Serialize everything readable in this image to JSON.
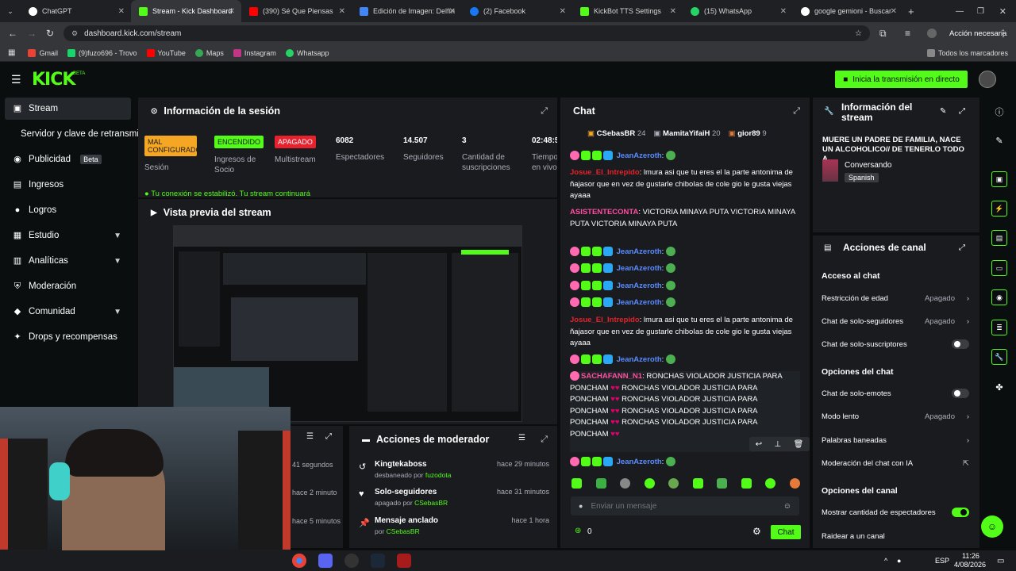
{
  "browser": {
    "tabs": [
      {
        "title": "ChatGPT",
        "color": "#ffffff"
      },
      {
        "title": "Stream - Kick Dashboard",
        "color": "#53fc18"
      },
      {
        "title": "(390) Sé Que Piensas",
        "color": "#ff0000"
      },
      {
        "title": "Edición de Imagen: Delfín",
        "color": "#4285f4"
      },
      {
        "title": "(2) Facebook",
        "color": "#1877f2"
      },
      {
        "title": "KickBot TTS Settings",
        "color": "#53fc18"
      },
      {
        "title": "(15) WhatsApp",
        "color": "#25d366"
      },
      {
        "title": "google gemioni - Buscar",
        "color": "#ffffff"
      }
    ],
    "new_tab": "+",
    "url": "dashboard.kick.com/stream",
    "action_label": "Acción necesaria",
    "bookmarks": [
      "Gmail",
      "(9)fuzo696 - Trovo",
      "YouTube",
      "Maps",
      "Instagram",
      "Whatsapp"
    ],
    "all_bookmarks": "Todos los marcadores"
  },
  "kick": {
    "logo": "KICK",
    "logo_tag": "BETA",
    "go_live": "Inicia la transmisión en directo",
    "sidebar": [
      {
        "label": "Stream",
        "icon": "stream-icon"
      },
      {
        "label": "Servidor y clave de retransmisión",
        "icon": ""
      },
      {
        "label": "Publicidad",
        "icon": "megaphone-icon",
        "badge": "Beta"
      },
      {
        "label": "Ingresos",
        "icon": "money-icon"
      },
      {
        "label": "Logros",
        "icon": "trophy-icon"
      },
      {
        "label": "Estudio",
        "icon": "studio-icon"
      },
      {
        "label": "Analíticas",
        "icon": "chart-icon"
      },
      {
        "label": "Moderación",
        "icon": "shield-icon"
      },
      {
        "label": "Comunidad",
        "icon": "community-icon"
      },
      {
        "label": "Drops y recompensas",
        "icon": "gift-icon"
      }
    ],
    "session": {
      "title": "Información de la sesión",
      "stats": [
        {
          "value": "MAL CONFIGURADO",
          "label": "Sesión",
          "badge_color": "#f5a623"
        },
        {
          "value": "ENCENDIDO",
          "label": "Ingresos de Socio",
          "badge_color": "#53fc18"
        },
        {
          "value": "APAGADO",
          "label": "Multistream",
          "badge_color": "#e5222d"
        },
        {
          "value": "6082",
          "label": "Espectadores"
        },
        {
          "value": "14.507",
          "label": "Seguidores"
        },
        {
          "value": "3",
          "label": "Cantidad de suscripciones"
        },
        {
          "value": "02:48:5",
          "label": "Tiempo en vivo"
        }
      ],
      "connection": "Tu conexión se estabilizó. Tu stream continuará"
    },
    "preview": {
      "title": "Vista previa del stream"
    },
    "mod_actions": {
      "title": "Acciones de moderador",
      "items": [
        {
          "title": "Kingtekaboss",
          "sub_pre": "desbaneado por",
          "sub_user": "fuzodota",
          "time": "hace 29 minutos"
        },
        {
          "title": "Solo-seguidores",
          "sub_pre": "apagado por",
          "sub_user": "CSebasBR",
          "time": "hace 31 minutos"
        },
        {
          "title": "Mensaje anclado",
          "sub_pre": "por",
          "sub_user": "CSebasBR",
          "time": "hace 1 hora"
        }
      ],
      "left_times": [
        "41 segundos",
        "hace 2 minuto",
        "hace 5 minutos"
      ]
    },
    "chat": {
      "title": "Chat",
      "top": [
        {
          "name": "CSebasBR",
          "count": "24"
        },
        {
          "name": "MamitaYifaiH",
          "count": "20"
        },
        {
          "name": "gior89",
          "count": "9"
        }
      ],
      "messages": [
        {
          "user": "JeanAzeroth",
          "text": "",
          "color": "#5b8cff"
        },
        {
          "user": "Josue_El_Intrepido",
          "text": "lmura asi que tu eres el la parte antonima de ñajasor que en vez de gustarle chiboIas de cole gio le gusta viejas ayaaa",
          "color": "#e5222d"
        },
        {
          "user": "ASISTENTECONTA",
          "text": "VICTORIA MINAYA PUTA VICTORIA MINAYA PUTA VICTORIA MINAYA PUTA",
          "color": "#ff4fa0"
        },
        {
          "user": "JeanAzeroth",
          "text": "",
          "color": "#5b8cff"
        },
        {
          "user": "JeanAzeroth",
          "text": "",
          "color": "#5b8cff"
        },
        {
          "user": "JeanAzeroth",
          "text": "",
          "color": "#5b8cff"
        },
        {
          "user": "JeanAzeroth",
          "text": "",
          "color": "#5b8cff"
        },
        {
          "user": "Josue_El_Intrepido",
          "text": "lmura asi que tu eres el la parte antonima de ñajasor que en vez de gustarle chiboIas de cole gio le gusta viejas ayaaa",
          "color": "#e5222d"
        },
        {
          "user": "JeanAzeroth",
          "text": "",
          "color": "#5b8cff"
        },
        {
          "user": "SACHAFANN_N1",
          "text": "RONCHAS VIOLADOR JUSTICIA PARA",
          "color": "#ff4fa0"
        },
        {
          "user": "JeanAzeroth",
          "text": "",
          "color": "#5b8cff"
        }
      ],
      "spam_lines": [
        [
          "PONCHAM",
          "RONCHAS VIOLADOR JUSTICIA PARA"
        ],
        [
          "PONCHAM",
          "RONCHAS VIOLADOR JUSTICIA PARA"
        ],
        [
          "PONCHAM",
          "RONCHAS VIOLADOR JUSTICIA PARA"
        ],
        [
          "PONCHAM",
          "RONCHAS VIOLADOR JUSTICIA PARA"
        ],
        [
          "PONCHAM",
          ""
        ]
      ],
      "input_placeholder": "Enviar un mensaje",
      "points": "0",
      "send_label": "Chat"
    },
    "channel_info": {
      "title": "Información del stream",
      "stream_title": "MUERE UN PADRE DE FAMILIA, NACE UN ALCOHOLICO// DE TENERLO TODO A...",
      "category": "Conversando",
      "language": "Spanish"
    },
    "channel_actions": {
      "title": "Acciones de canal",
      "sections": [
        {
          "heading": "Acceso al chat",
          "rows": [
            {
              "label": "Restricción de edad",
              "value": "Apagado",
              "kind": "arrow"
            },
            {
              "label": "Chat de solo-seguidores",
              "value": "Apagado",
              "kind": "arrow"
            },
            {
              "label": "Chat de solo-suscriptores",
              "value": "",
              "kind": "toggle-off"
            }
          ]
        },
        {
          "heading": "Opciones del chat",
          "rows": [
            {
              "label": "Chat de solo-emotes",
              "value": "",
              "kind": "toggle-off"
            },
            {
              "label": "Modo lento",
              "value": "Apagado",
              "kind": "arrow"
            },
            {
              "label": "Palabras baneadas",
              "value": "",
              "kind": "arrow"
            },
            {
              "label": "Moderación del chat con IA",
              "value": "",
              "kind": "external"
            }
          ]
        },
        {
          "heading": "Opciones del canal",
          "rows": [
            {
              "label": "Mostrar cantidad de espectadores",
              "value": "",
              "kind": "toggle-on"
            },
            {
              "label": "Raidear a un canal",
              "value": "",
              "kind": "none"
            }
          ]
        }
      ]
    }
  },
  "taskbar": {
    "time": "11:26",
    "date": "4/08/2026",
    "lang": "ESP"
  },
  "colors": {
    "accent": "#53fc18",
    "panel": "#191b1f",
    "bg": "#0b0e0f"
  }
}
